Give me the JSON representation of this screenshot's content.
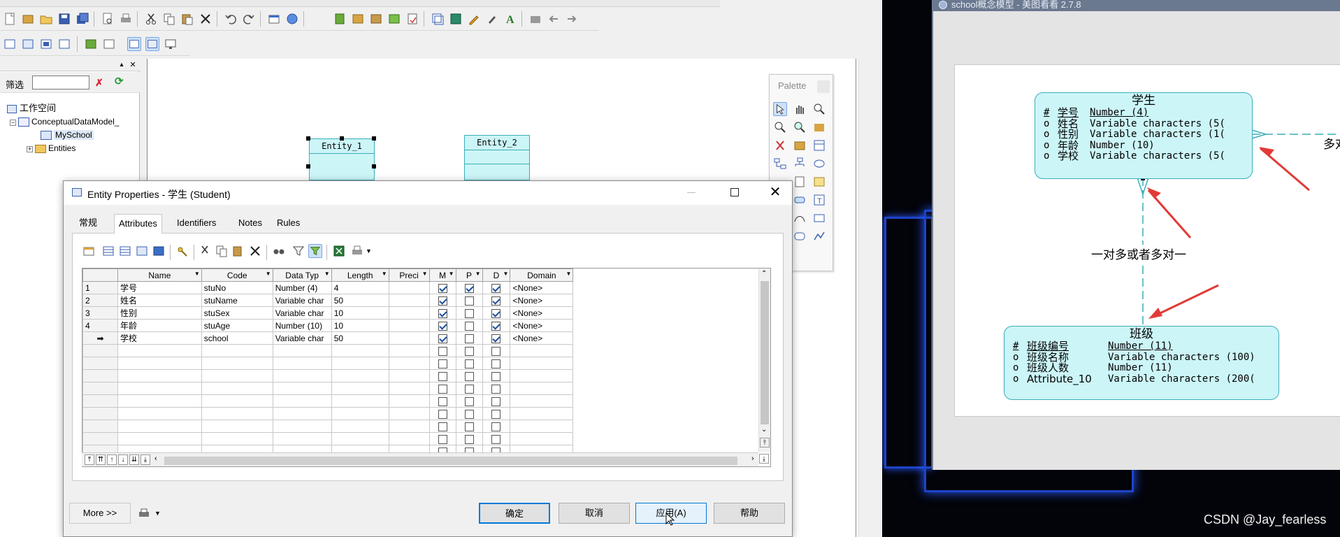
{
  "left_tree": {
    "filter_label": "筛选",
    "workspace": "工作空间",
    "model": "ConceptualDataModel_",
    "diagram": "MySchool",
    "entities": "Entities"
  },
  "canvas": {
    "entity1": "Entity_1",
    "entity2": "Entity_2"
  },
  "palette": {
    "title": "Palette"
  },
  "dialog": {
    "title": "Entity Properties - 学生 (Student)",
    "tabs": [
      "常规",
      "Attributes",
      "Identifiers",
      "Notes",
      "Rules"
    ],
    "active_tab": "Attributes",
    "columns": [
      "Name",
      "Code",
      "Data Typ",
      "Length",
      "Preci",
      "M",
      "P",
      "D",
      "Domain"
    ],
    "rows": [
      {
        "num": "1",
        "name": "学号",
        "code": "stuNo",
        "type": "Number (4)",
        "length": "4",
        "m": true,
        "p": true,
        "d": true,
        "domain": "<None>"
      },
      {
        "num": "2",
        "name": "姓名",
        "code": "stuName",
        "type": "Variable char",
        "length": "50",
        "m": true,
        "p": false,
        "d": true,
        "domain": "<None>"
      },
      {
        "num": "3",
        "name": "性别",
        "code": "stuSex",
        "type": "Variable char",
        "length": "10",
        "m": true,
        "p": false,
        "d": true,
        "domain": "<None>"
      },
      {
        "num": "4",
        "name": "年龄",
        "code": "stuAge",
        "type": "Number (10)",
        "length": "10",
        "m": true,
        "p": false,
        "d": true,
        "domain": "<None>"
      },
      {
        "num": "➡",
        "name": "学校",
        "code": "school",
        "type": "Variable char",
        "length": "50",
        "m": true,
        "p": false,
        "d": true,
        "domain": "<None>"
      }
    ],
    "empty_rows": 9,
    "buttons": {
      "more": "More >>",
      "ok": "确定",
      "cancel": "取消",
      "apply": "应用(A)",
      "help": "帮助"
    }
  },
  "viewer": {
    "title": "school概念模型 - 美图看看 2.7.8",
    "student_entity": {
      "name": "学生",
      "attrs": [
        {
          "marker": "#",
          "name": "学号",
          "type": "Number (4)"
        },
        {
          "marker": "o",
          "name": "姓名",
          "type": "Variable characters (5("
        },
        {
          "marker": "o",
          "name": "性别",
          "type": "Variable characters (1("
        },
        {
          "marker": "o",
          "name": "年龄",
          "type": "Number (10)"
        },
        {
          "marker": "o",
          "name": "学校",
          "type": "Variable characters (5("
        }
      ]
    },
    "class_entity": {
      "name": "班级",
      "attrs": [
        {
          "marker": "#",
          "name": "班级编号",
          "type": "Number (11)"
        },
        {
          "marker": "o",
          "name": "班级名称",
          "type": "Variable characters (100)"
        },
        {
          "marker": "o",
          "name": "班级人数",
          "type": "Number (11)"
        },
        {
          "marker": "o",
          "name": "Attribute_10",
          "type": "Variable characters (200("
        }
      ]
    },
    "relation_label": "一对多或者多对一",
    "relation_label_right": "多对"
  },
  "watermark": "CSDN @Jay_fearless",
  "colors": {
    "entity_fill": "#ccf5f7",
    "entity_border": "#3aaeb8",
    "arrow": "#e23a36",
    "accent": "#0066cc"
  }
}
